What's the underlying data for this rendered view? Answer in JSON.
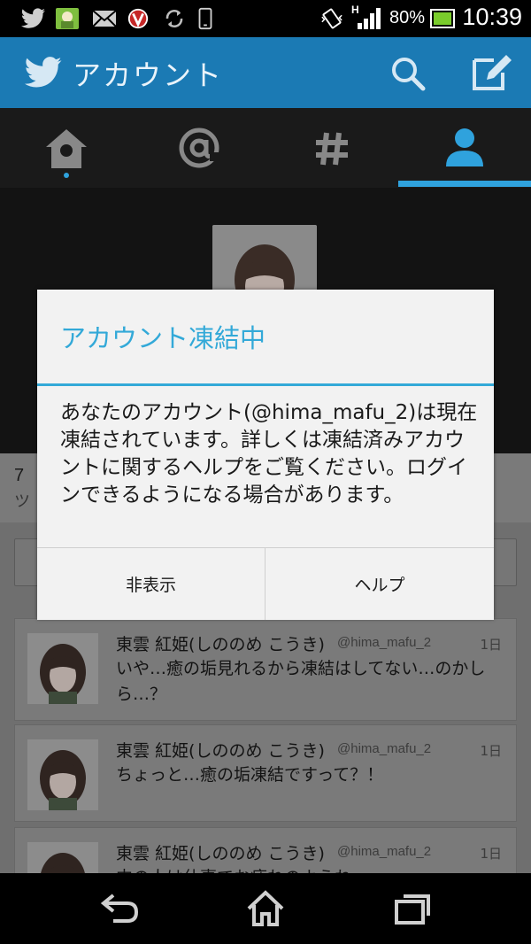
{
  "status_bar": {
    "battery_percent": "80%",
    "time": "10:39",
    "network": "H"
  },
  "action_bar": {
    "title": "アカウント"
  },
  "tabs": [
    {
      "name": "home"
    },
    {
      "name": "mentions"
    },
    {
      "name": "discover"
    },
    {
      "name": "me",
      "selected": true
    }
  ],
  "profile": {
    "stats_number": "7",
    "stats_label": "ツ"
  },
  "tweets": [
    {
      "name": "東雲 紅姫(しののめ こうき)",
      "handle": "@hima_mafu_2",
      "time": "1日",
      "text": "いや…癒の垢見れるから凍結はしてない…のかしら…？"
    },
    {
      "name": "東雲 紅姫(しののめ こうき)",
      "handle": "@hima_mafu_2",
      "time": "1日",
      "text": "ちょっと…癒の垢凍結ですって？！"
    },
    {
      "name": "東雲 紅姫(しののめ こうき)",
      "handle": "@hima_mafu_2",
      "time": "1日",
      "text": "中の人は仕事でお疲れのようね"
    }
  ],
  "dialog": {
    "title": "アカウント凍結中",
    "message": "あなたのアカウント(@hima_mafu_2)は現在凍結されています。詳しくは凍結済みアカウントに関するヘルプをご覧ください。ログインできるようになる場合があります。",
    "dismiss_label": "非表示",
    "help_label": "ヘルプ"
  },
  "colors": {
    "accent": "#33a9d8",
    "action_bar": "#1b7ab4",
    "tab_indicator": "#2fa2dd"
  }
}
